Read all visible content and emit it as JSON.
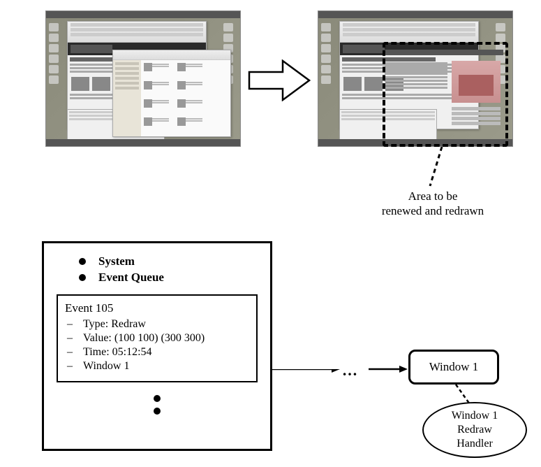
{
  "annotation": {
    "line1": "Area to be",
    "line2": "renewed and redrawn"
  },
  "system": {
    "header_items": [
      "System",
      "Event Queue"
    ],
    "event": {
      "title": "Event 105",
      "lines": [
        "Type: Redraw",
        "Value: (100 100) (300 300)",
        "Time: 05:12:54",
        "Window 1"
      ]
    }
  },
  "flow": {
    "ellipsis": "…",
    "window_label": "Window 1",
    "handler_line1": "Window 1",
    "handler_line2": "Redraw",
    "handler_line3": "Handler"
  }
}
